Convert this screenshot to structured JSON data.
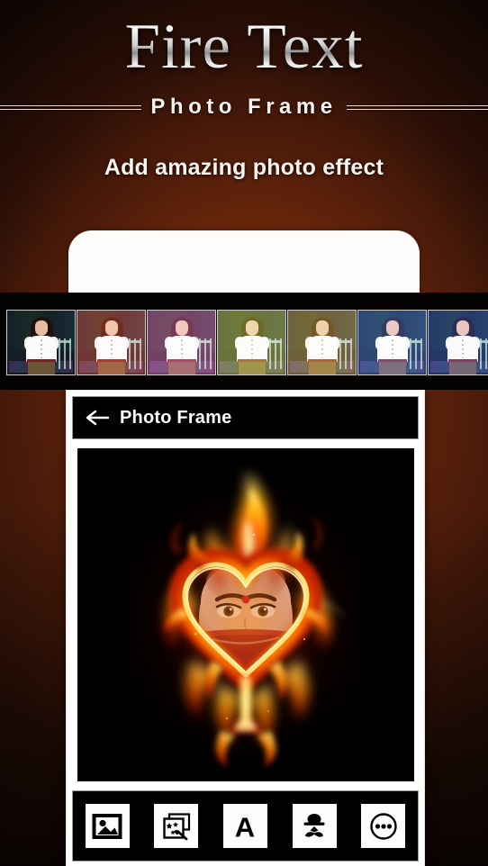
{
  "promo": {
    "app_title": "Fire Text",
    "app_subtitle": "Photo Frame",
    "tagline": "Add amazing photo effect",
    "background_colors": {
      "dark": "#0a0403",
      "mid": "#36150a",
      "accent": "#5a2410"
    },
    "title_color": "#ffffff"
  },
  "filmstrip": {
    "name": "filter-preview-strip",
    "background": "#050302",
    "thumb_border": "#cfcbc8",
    "thumbnails": [
      {
        "label": "Original",
        "tint": "#000000",
        "opacity": 0
      },
      {
        "label": "Warm Red",
        "tint": "#d8402a",
        "opacity": 0.45
      },
      {
        "label": "Pink",
        "tint": "#e45aa8",
        "opacity": 0.45
      },
      {
        "label": "Yellow Green",
        "tint": "#cfd43a",
        "opacity": 0.45
      },
      {
        "label": "Golden",
        "tint": "#d8a63a",
        "opacity": 0.45
      },
      {
        "label": "Cool Blue",
        "tint": "#3f6ad8",
        "opacity": 0.42
      },
      {
        "label": "Indigo",
        "tint": "#2a46b8",
        "opacity": 0.42
      }
    ]
  },
  "phone": {
    "appbar": {
      "back_icon": "arrow-left-icon",
      "title": "Photo Frame"
    },
    "canvas": {
      "name": "photo-canvas",
      "description": "Flaming heart frame with woman's face inside",
      "background": "#000000",
      "flame_colors": {
        "core": "#fff3a8",
        "inner": "#ffb21e",
        "mid": "#ff6a00",
        "outer": "#c01a06",
        "edge": "#6a0a03"
      },
      "skin": "#e7b79c"
    },
    "toolbar": {
      "buttons": [
        {
          "name": "gallery-button",
          "icon": "image-icon",
          "label": "Gallery"
        },
        {
          "name": "effects-button",
          "icon": "magic-wand-icon",
          "label": "Effects"
        },
        {
          "name": "text-button",
          "icon": "letter-a-icon",
          "label": "Text"
        },
        {
          "name": "sticker-button",
          "icon": "sticker-hat-mustache-icon",
          "label": "Sticker"
        },
        {
          "name": "more-button",
          "icon": "more-dots-icon",
          "label": "More"
        }
      ],
      "button_background": "#fdfdfd",
      "bar_background": "#000000"
    }
  }
}
